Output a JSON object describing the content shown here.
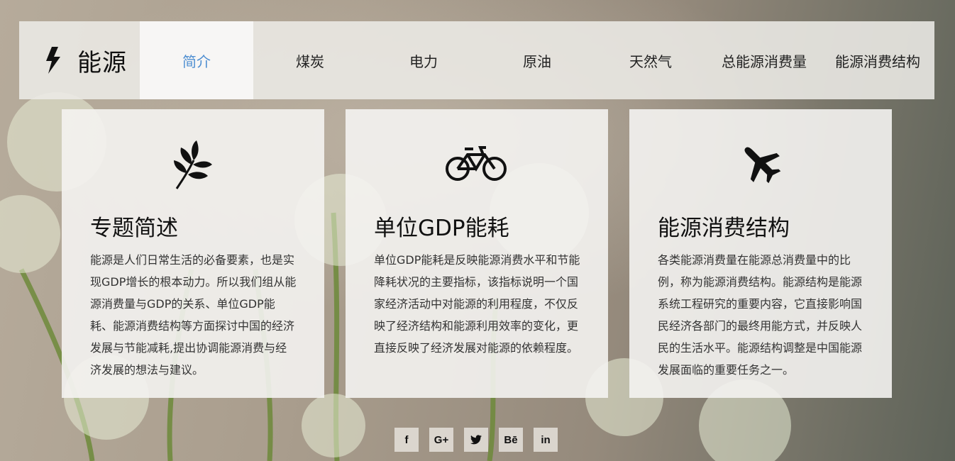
{
  "brand": {
    "title": "能源",
    "icon": "lightning-bolt-icon"
  },
  "nav": {
    "items": [
      {
        "label": "简介",
        "active": true
      },
      {
        "label": "煤炭"
      },
      {
        "label": "电力"
      },
      {
        "label": "原油"
      },
      {
        "label": "天然气"
      },
      {
        "label": "总能源消费量"
      },
      {
        "label": "能源消费结构"
      }
    ]
  },
  "cards": [
    {
      "icon": "leaf-branch-icon",
      "title": "专题简述",
      "body": "能源是人们日常生活的必备要素，也是实现GDP增长的根本动力。所以我们组从能源消费量与GDP的关系、单位GDP能耗、能源消费结构等方面探讨中国的经济发展与节能减耗,提出协调能源消费与经济发展的想法与建议。"
    },
    {
      "icon": "bicycle-icon",
      "title": "单位GDP能耗",
      "body": "单位GDP能耗是反映能源消费水平和节能降耗状况的主要指标，该指标说明一个国家经济活动中对能源的利用程度，不仅反映了经济结构和能源利用效率的变化，更直接反映了经济发展对能源的依赖程度。"
    },
    {
      "icon": "airplane-icon",
      "title": "能源消费结构",
      "body": "各类能源消费量在能源总消费量中的比例，称为能源消费结构。能源结构是能源系统工程研究的重要内容，它直接影响国民经济各部门的最终用能方式，并反映人民的生活水平。能源结构调整是中国能源发展面临的重要任务之一。"
    }
  ],
  "social": [
    {
      "label": "f",
      "icon": "facebook-icon"
    },
    {
      "label": "G+",
      "icon": "google-plus-icon"
    },
    {
      "label": "🐦",
      "icon": "twitter-icon"
    },
    {
      "label": "Bē",
      "icon": "behance-icon"
    },
    {
      "label": "in",
      "icon": "linkedin-icon"
    }
  ],
  "colors": {
    "nav_active": "#4e8ed1",
    "text": "#111111"
  }
}
